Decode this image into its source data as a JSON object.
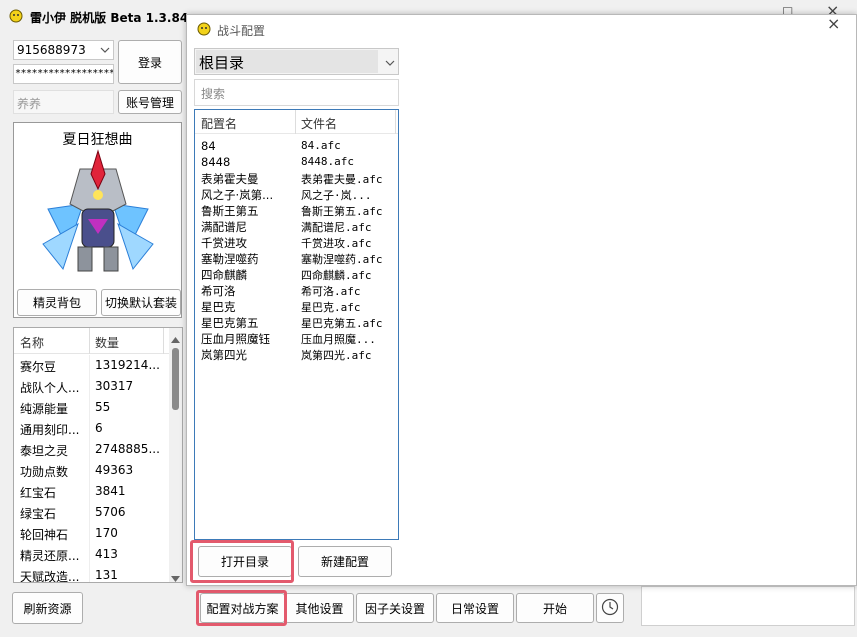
{
  "main_window": {
    "title": "雷小伊 脱机版 Beta 1.3.84",
    "close_glyph": "×",
    "restore_glyph": "□",
    "account": {
      "value": "915688973",
      "password_mask": "******************"
    },
    "login_label": "登录",
    "account_manage_label": "账号管理",
    "nickname_placeholder": "养养",
    "character": {
      "name": "夏日狂想曲"
    },
    "sprite_bag_label": "精灵背包",
    "switch_outfit_label": "切换默认套装",
    "resources": {
      "headers": [
        "名称",
        "数量"
      ],
      "rows": [
        [
          "赛尔豆",
          "1319214..."
        ],
        [
          "战队个人...",
          "30317"
        ],
        [
          "纯源能量",
          "55"
        ],
        [
          "通用刻印...",
          "6"
        ],
        [
          "泰坦之灵",
          "2748885..."
        ],
        [
          "功勋点数",
          "49363"
        ],
        [
          "红宝石",
          "3841"
        ],
        [
          "绿宝石",
          "5706"
        ],
        [
          "轮回神石",
          "170"
        ],
        [
          "精灵还原...",
          "413"
        ],
        [
          "天赋改造...",
          "131"
        ]
      ]
    },
    "refresh_label": "刷新资源",
    "bottom_buttons": [
      "配置对战方案",
      "其他设置",
      "因子关设置",
      "日常设置",
      "开始"
    ]
  },
  "dialog": {
    "title": "战斗配置",
    "close_glyph": "×",
    "directory_selected": "根目录",
    "search_placeholder": "搜索",
    "headers": [
      "配置名",
      "文件名"
    ],
    "rows": [
      [
        "84",
        "84.afc"
      ],
      [
        "8448",
        "8448.afc"
      ],
      [
        "表弟霍夫曼",
        "表弟霍夫曼.afc"
      ],
      [
        "风之子·岚第...",
        "风之子·岚..."
      ],
      [
        "鲁斯王第五",
        "鲁斯王第五.afc"
      ],
      [
        "满配谱尼",
        "满配谱尼.afc"
      ],
      [
        "千赏进攻",
        "千赏进攻.afc"
      ],
      [
        "塞勒涅噬药",
        "塞勒涅噬药.afc"
      ],
      [
        "四命麒麟",
        "四命麒麟.afc"
      ],
      [
        "希可洛",
        "希可洛.afc"
      ],
      [
        "星巴克",
        "星巴克.afc"
      ],
      [
        "星巴克第五",
        "星巴克第五.afc"
      ],
      [
        "压血月照魔钰",
        "压血月照魔..."
      ],
      [
        "岚第四光",
        "岚第四光.afc"
      ]
    ],
    "open_dir_label": "打开目录",
    "new_config_label": "新建配置"
  },
  "colors": {
    "highlight": "#e35a6d",
    "list_border": "#3d7ab8",
    "window_bg": "#f0f0f0",
    "dialog_bg": "#ffffff"
  }
}
